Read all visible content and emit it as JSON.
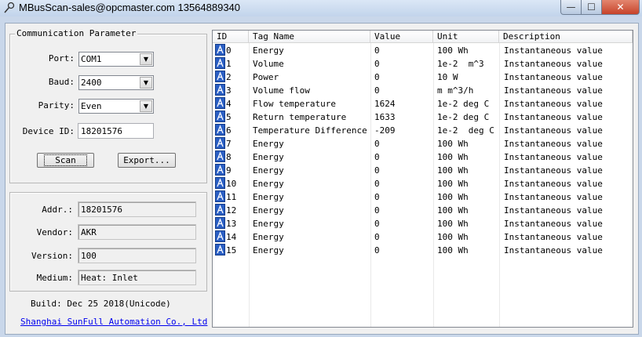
{
  "window": {
    "title": "MBusScan-sales@opcmaster.com 13564889340",
    "min_glyph": "—",
    "max_glyph": "☐",
    "close_glyph": "✕"
  },
  "comm": {
    "group_label": "Communication Parameter",
    "port_label": "Port:",
    "port_value": "COM1",
    "baud_label": "Baud:",
    "baud_value": "2400",
    "parity_label": "Parity:",
    "parity_value": "Even",
    "device_id_label": "Device ID:",
    "device_id_value": "18201576",
    "scan_label": "Scan",
    "export_label": "Export..."
  },
  "info": {
    "addr_label": "Addr.:",
    "addr_value": "18201576",
    "vendor_label": "Vendor:",
    "vendor_value": "AKR",
    "version_label": "Version:",
    "version_value": "100",
    "medium_label": "Medium:",
    "medium_value": "Heat: Inlet"
  },
  "footer": {
    "build": "Build: Dec 25 2018(Unicode)",
    "company_link": "Shanghai SunFull Automation Co., Ltd"
  },
  "table": {
    "columns": [
      "ID",
      "Tag Name",
      "Value",
      "Unit",
      "Description"
    ],
    "rows": [
      {
        "id": "0",
        "tag": "Energy",
        "value": "0",
        "unit": "100 Wh",
        "desc": "Instantaneous value"
      },
      {
        "id": "1",
        "tag": "Volume",
        "value": "0",
        "unit": "1e-2  m^3",
        "desc": "Instantaneous value"
      },
      {
        "id": "2",
        "tag": "Power",
        "value": "0",
        "unit": "10 W",
        "desc": "Instantaneous value"
      },
      {
        "id": "3",
        "tag": "Volume flow",
        "value": "0",
        "unit": "m m^3/h",
        "desc": "Instantaneous value"
      },
      {
        "id": "4",
        "tag": "Flow temperature",
        "value": "1624",
        "unit": "1e-2 deg C",
        "desc": "Instantaneous value"
      },
      {
        "id": "5",
        "tag": "Return temperature",
        "value": "1633",
        "unit": "1e-2 deg C",
        "desc": "Instantaneous value"
      },
      {
        "id": "6",
        "tag": "Temperature Difference",
        "value": "-209",
        "unit": "1e-2  deg C",
        "desc": "Instantaneous value"
      },
      {
        "id": "7",
        "tag": "Energy",
        "value": "0",
        "unit": "100 Wh",
        "desc": "Instantaneous value"
      },
      {
        "id": "8",
        "tag": "Energy",
        "value": "0",
        "unit": "100 Wh",
        "desc": "Instantaneous value"
      },
      {
        "id": "9",
        "tag": "Energy",
        "value": "0",
        "unit": "100 Wh",
        "desc": "Instantaneous value"
      },
      {
        "id": "10",
        "tag": "Energy",
        "value": "0",
        "unit": "100 Wh",
        "desc": "Instantaneous value"
      },
      {
        "id": "11",
        "tag": "Energy",
        "value": "0",
        "unit": "100 Wh",
        "desc": "Instantaneous value"
      },
      {
        "id": "12",
        "tag": "Energy",
        "value": "0",
        "unit": "100 Wh",
        "desc": "Instantaneous value"
      },
      {
        "id": "13",
        "tag": "Energy",
        "value": "0",
        "unit": "100 Wh",
        "desc": "Instantaneous value"
      },
      {
        "id": "14",
        "tag": "Energy",
        "value": "0",
        "unit": "100 Wh",
        "desc": "Instantaneous value"
      },
      {
        "id": "15",
        "tag": "Energy",
        "value": "0",
        "unit": "100 Wh",
        "desc": "Instantaneous value"
      }
    ]
  },
  "colors": {
    "link": "#0000ee",
    "tag_icon": "#2b5fc4"
  }
}
